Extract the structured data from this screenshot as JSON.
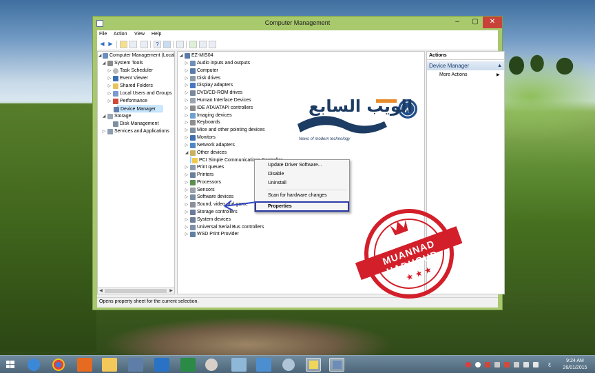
{
  "window": {
    "title": "Computer Management",
    "menu": [
      "File",
      "Action",
      "View",
      "Help"
    ]
  },
  "left_tree": [
    {
      "label": "Computer Management (Local",
      "icon": "computer-management-icon",
      "expanded": true
    },
    {
      "label": "System Tools",
      "icon": "system-tools-icon",
      "expanded": true
    },
    {
      "label": "Task Scheduler",
      "icon": "clock-icon"
    },
    {
      "label": "Event Viewer",
      "icon": "event-viewer-icon"
    },
    {
      "label": "Shared Folders",
      "icon": "folder-icon"
    },
    {
      "label": "Local Users and Groups",
      "icon": "users-icon"
    },
    {
      "label": "Performance",
      "icon": "performance-icon"
    },
    {
      "label": "Device Manager",
      "icon": "device-manager-icon",
      "selected": true
    },
    {
      "label": "Storage",
      "icon": "storage-icon",
      "expanded": true
    },
    {
      "label": "Disk Management",
      "icon": "disk-icon"
    },
    {
      "label": "Services and Applications",
      "icon": "services-icon"
    }
  ],
  "device_tree": {
    "root": "EZ-MIS04",
    "categories": [
      "Audio inputs and outputs",
      "Computer",
      "Disk drives",
      "Display adapters",
      "DVD/CD-ROM drives",
      "Human Interface Devices",
      "IDE ATA/ATAPI controllers",
      "Imaging devices",
      "Keyboards",
      "Mice and other pointing devices",
      "Monitors",
      "Network adapters",
      "Other devices",
      "PCI Simple Communications Controller",
      "Print queues",
      "Printers",
      "Processors",
      "Sensors",
      "Software devices",
      "Sound, video and game",
      "Storage controllers",
      "System devices",
      "Universal Serial Bus controllers",
      "WSD Print Provider"
    ]
  },
  "context_menu": {
    "items": [
      "Update Driver Software...",
      "Disable",
      "Uninstall",
      "Scan for hardware changes",
      "Properties"
    ]
  },
  "actions": {
    "header": "Actions",
    "section": "Device Manager",
    "more": "More Actions"
  },
  "status": "Opens property sheet for the current selection.",
  "watermark": {
    "arabic": "الويب السابع",
    "tagline": "News of modern technology",
    "stamp": "MUANNAD HADHOUD"
  },
  "taskbar": {
    "time": "9:24 AM",
    "date": "26/01/2015",
    "lang": "ع",
    "apps": [
      "start-icon",
      "internet-explorer-icon",
      "chrome-icon",
      "media-player-icon",
      "file-explorer-icon",
      "remote-desktop-icon",
      "outlook-icon",
      "excel-icon",
      "paint-icon",
      "calculator-icon",
      "network-icon",
      "photo-viewer-icon",
      "sticky-notes-icon",
      "computer-management-icon"
    ]
  },
  "colors": {
    "titlebar": "#a9c96d",
    "close": "#c7433a",
    "selection": "#cce8ff",
    "highlight_box": "#2b3aa8"
  }
}
